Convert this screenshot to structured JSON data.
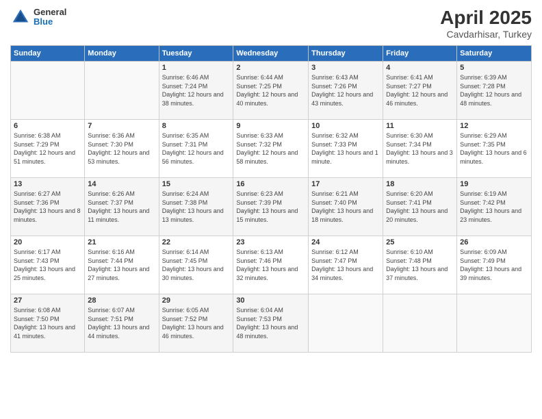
{
  "header": {
    "logo_general": "General",
    "logo_blue": "Blue",
    "main_title": "April 2025",
    "sub_title": "Cavdarhisar, Turkey"
  },
  "calendar": {
    "days_of_week": [
      "Sunday",
      "Monday",
      "Tuesday",
      "Wednesday",
      "Thursday",
      "Friday",
      "Saturday"
    ],
    "weeks": [
      [
        {
          "day": "",
          "info": ""
        },
        {
          "day": "",
          "info": ""
        },
        {
          "day": "1",
          "info": "Sunrise: 6:46 AM\nSunset: 7:24 PM\nDaylight: 12 hours and 38 minutes."
        },
        {
          "day": "2",
          "info": "Sunrise: 6:44 AM\nSunset: 7:25 PM\nDaylight: 12 hours and 40 minutes."
        },
        {
          "day": "3",
          "info": "Sunrise: 6:43 AM\nSunset: 7:26 PM\nDaylight: 12 hours and 43 minutes."
        },
        {
          "day": "4",
          "info": "Sunrise: 6:41 AM\nSunset: 7:27 PM\nDaylight: 12 hours and 46 minutes."
        },
        {
          "day": "5",
          "info": "Sunrise: 6:39 AM\nSunset: 7:28 PM\nDaylight: 12 hours and 48 minutes."
        }
      ],
      [
        {
          "day": "6",
          "info": "Sunrise: 6:38 AM\nSunset: 7:29 PM\nDaylight: 12 hours and 51 minutes."
        },
        {
          "day": "7",
          "info": "Sunrise: 6:36 AM\nSunset: 7:30 PM\nDaylight: 12 hours and 53 minutes."
        },
        {
          "day": "8",
          "info": "Sunrise: 6:35 AM\nSunset: 7:31 PM\nDaylight: 12 hours and 56 minutes."
        },
        {
          "day": "9",
          "info": "Sunrise: 6:33 AM\nSunset: 7:32 PM\nDaylight: 12 hours and 58 minutes."
        },
        {
          "day": "10",
          "info": "Sunrise: 6:32 AM\nSunset: 7:33 PM\nDaylight: 13 hours and 1 minute."
        },
        {
          "day": "11",
          "info": "Sunrise: 6:30 AM\nSunset: 7:34 PM\nDaylight: 13 hours and 3 minutes."
        },
        {
          "day": "12",
          "info": "Sunrise: 6:29 AM\nSunset: 7:35 PM\nDaylight: 13 hours and 6 minutes."
        }
      ],
      [
        {
          "day": "13",
          "info": "Sunrise: 6:27 AM\nSunset: 7:36 PM\nDaylight: 13 hours and 8 minutes."
        },
        {
          "day": "14",
          "info": "Sunrise: 6:26 AM\nSunset: 7:37 PM\nDaylight: 13 hours and 11 minutes."
        },
        {
          "day": "15",
          "info": "Sunrise: 6:24 AM\nSunset: 7:38 PM\nDaylight: 13 hours and 13 minutes."
        },
        {
          "day": "16",
          "info": "Sunrise: 6:23 AM\nSunset: 7:39 PM\nDaylight: 13 hours and 15 minutes."
        },
        {
          "day": "17",
          "info": "Sunrise: 6:21 AM\nSunset: 7:40 PM\nDaylight: 13 hours and 18 minutes."
        },
        {
          "day": "18",
          "info": "Sunrise: 6:20 AM\nSunset: 7:41 PM\nDaylight: 13 hours and 20 minutes."
        },
        {
          "day": "19",
          "info": "Sunrise: 6:19 AM\nSunset: 7:42 PM\nDaylight: 13 hours and 23 minutes."
        }
      ],
      [
        {
          "day": "20",
          "info": "Sunrise: 6:17 AM\nSunset: 7:43 PM\nDaylight: 13 hours and 25 minutes."
        },
        {
          "day": "21",
          "info": "Sunrise: 6:16 AM\nSunset: 7:44 PM\nDaylight: 13 hours and 27 minutes."
        },
        {
          "day": "22",
          "info": "Sunrise: 6:14 AM\nSunset: 7:45 PM\nDaylight: 13 hours and 30 minutes."
        },
        {
          "day": "23",
          "info": "Sunrise: 6:13 AM\nSunset: 7:46 PM\nDaylight: 13 hours and 32 minutes."
        },
        {
          "day": "24",
          "info": "Sunrise: 6:12 AM\nSunset: 7:47 PM\nDaylight: 13 hours and 34 minutes."
        },
        {
          "day": "25",
          "info": "Sunrise: 6:10 AM\nSunset: 7:48 PM\nDaylight: 13 hours and 37 minutes."
        },
        {
          "day": "26",
          "info": "Sunrise: 6:09 AM\nSunset: 7:49 PM\nDaylight: 13 hours and 39 minutes."
        }
      ],
      [
        {
          "day": "27",
          "info": "Sunrise: 6:08 AM\nSunset: 7:50 PM\nDaylight: 13 hours and 41 minutes."
        },
        {
          "day": "28",
          "info": "Sunrise: 6:07 AM\nSunset: 7:51 PM\nDaylight: 13 hours and 44 minutes."
        },
        {
          "day": "29",
          "info": "Sunrise: 6:05 AM\nSunset: 7:52 PM\nDaylight: 13 hours and 46 minutes."
        },
        {
          "day": "30",
          "info": "Sunrise: 6:04 AM\nSunset: 7:53 PM\nDaylight: 13 hours and 48 minutes."
        },
        {
          "day": "",
          "info": ""
        },
        {
          "day": "",
          "info": ""
        },
        {
          "day": "",
          "info": ""
        }
      ]
    ]
  }
}
